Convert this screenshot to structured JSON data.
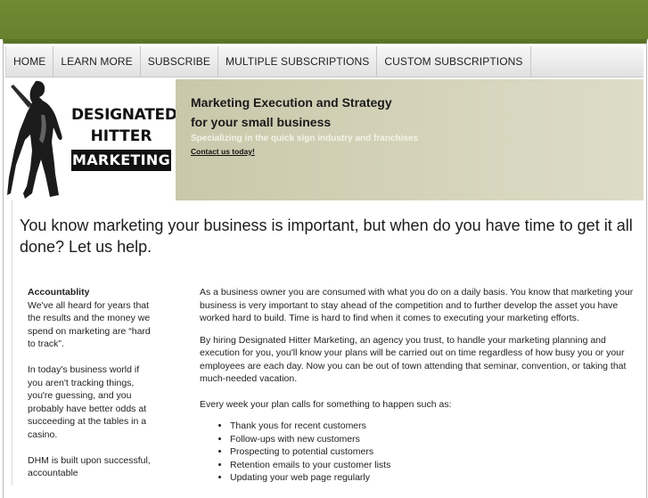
{
  "nav": {
    "items": [
      "HOME",
      "LEARN MORE",
      "SUBSCRIBE",
      "MULTIPLE SUBSCRIPTIONS",
      "CUSTOM SUBSCRIPTIONS"
    ]
  },
  "logo": {
    "line1": "DESIGNATED",
    "line2": "HITTER",
    "line3": "MARKETING"
  },
  "banner": {
    "title_line1": "Marketing Execution and Strategy",
    "title_line2": "for your small business",
    "subtitle": "Specializing in the quick sign industry and franchises",
    "contact_link": "Contact us today!"
  },
  "headline": "You know marketing your business is important, but when do you have time to get it all done? Let us help.",
  "sidebar": {
    "heading": "Accountablity",
    "para1": "We've all heard for years that the results and the money we spend on marketing are “hard to track”.",
    "para2": "In today's business world if you aren't tracking things, you're guessing, and you probably have better odds at succeeding at the tables in a casino.",
    "para3": "DHM is built upon successful, accountable"
  },
  "main": {
    "para1": "As a business owner you are consumed with what you do on a daily basis. You know that marketing your business is very important to stay ahead of the competition and to further develop the asset you have worked hard to build. Time is hard to find when it comes to executing your marketing efforts.",
    "para2": "By hiring Designated Hitter Marketing, an agency you trust, to handle your marketing planning and execution for you, you'll know your plans will be carried out on time regardless of how busy you or your employees are each day. Now you can be out of town attending that seminar, convention, or taking that much-needed vacation.",
    "para3": "Every week your plan calls for something to happen such as:",
    "list": [
      "Thank yous for recent customers",
      "Follow-ups with new customers",
      "Prospecting to potential customers",
      "Retention emails to your customer lists",
      "Updating your web page regularly"
    ]
  },
  "colors": {
    "topbar": "#6e8a32",
    "banner_bg": "#d6d5bc"
  }
}
